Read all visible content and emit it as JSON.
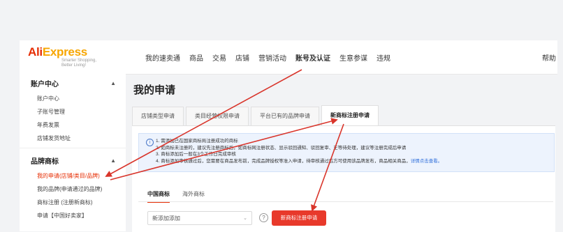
{
  "brand": {
    "name_a": "Ali",
    "name_b": "Express",
    "tagline": "Smarter Shopping, Better Living!"
  },
  "nav": {
    "items": [
      "我的速卖通",
      "商品",
      "交易",
      "店铺",
      "营销活动",
      "账号及认证",
      "生意参谋",
      "违规"
    ],
    "active": "账号及认证",
    "help": "帮助"
  },
  "sidebar": {
    "sections": [
      {
        "title": "账户中心",
        "items": [
          "账户中心",
          "子账号管理",
          "年费发票",
          "店铺发货地址"
        ]
      },
      {
        "title": "品牌商标",
        "items": [
          "我的申请(店铺/类目/品牌)",
          "我的品牌(申请通过的品牌)",
          "商标注册 (注册新商标)",
          "申请【中国好卖家】"
        ]
      }
    ],
    "active_item": "我的申请(店铺/类目/品牌)"
  },
  "main": {
    "title": "我的申请",
    "tabs": [
      "店铺类型申请",
      "类目经营权限申请",
      "平台已有的品牌申请",
      "新商标注册申请"
    ],
    "active_tab": "新商标注册申请",
    "notice": {
      "lines": [
        "1. 需添加已在国家商标局注册成功的商标",
        "2. 如商标未注册的，建议先注册商标后，如商标网注册状态、显示驳回通知、驳回复审、正等待处理，建议等注册完成后申请",
        "3. 商标添加后一般在3个工作日完成审核",
        "4. 商标添加审核通过后，您需要在商品发布前，完成品牌授权等准入申请，待审核通过后方可使用该品牌发布，商品相关商品，"
      ],
      "link": "详情点击查看。"
    },
    "subtabs": [
      "中国商标",
      "海外商标"
    ],
    "active_subtab": "中国商标",
    "select_value": "新添加添加",
    "cta_label": "新商标注册申请"
  }
}
